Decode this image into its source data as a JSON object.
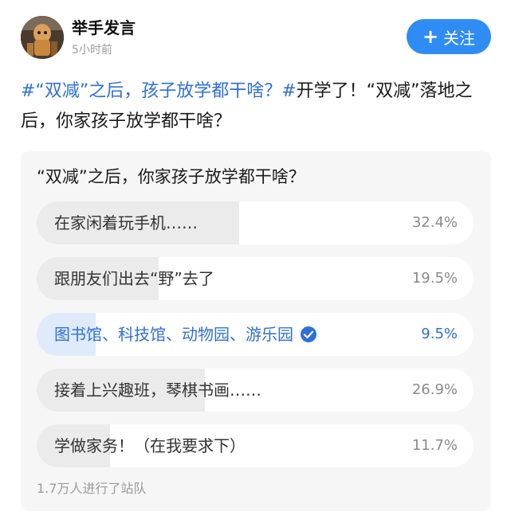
{
  "header": {
    "avatar_icon": "avatar-figurine-icon",
    "username": "举手发言",
    "time": "5小时前",
    "follow_icon": "plus-icon",
    "follow_label": "关注"
  },
  "post": {
    "hashtag": "#“双减”之后，孩子放学都干啥？#",
    "body": "开学了！“双减”落地之后，你家孩子放学都干啥？"
  },
  "poll": {
    "question": "“双减”之后，你家孩子放学都干啥？",
    "selected_index": 2,
    "selected_icon": "checkmark-circle-icon",
    "options": [
      {
        "label": "在家闲着玩手机……",
        "percent": "32.4%",
        "value": 32.4
      },
      {
        "label": "跟朋友们出去“野”去了",
        "percent": "19.5%",
        "value": 19.5
      },
      {
        "label": "图书馆、科技馆、动物园、游乐园",
        "percent": "9.5%",
        "value": 9.5
      },
      {
        "label": "接着上兴趣班，琴棋书画……",
        "percent": "26.9%",
        "value": 26.9
      },
      {
        "label": "学做家务！（在我要求下）",
        "percent": "11.7%",
        "value": 11.7
      }
    ],
    "participants": "1.7万人进行了站队"
  },
  "colors": {
    "accent": "#2f8cf5",
    "hashtag": "#2f6fd8",
    "selected_fill": "#dfeafb",
    "option_fill": "#ebebeb"
  }
}
